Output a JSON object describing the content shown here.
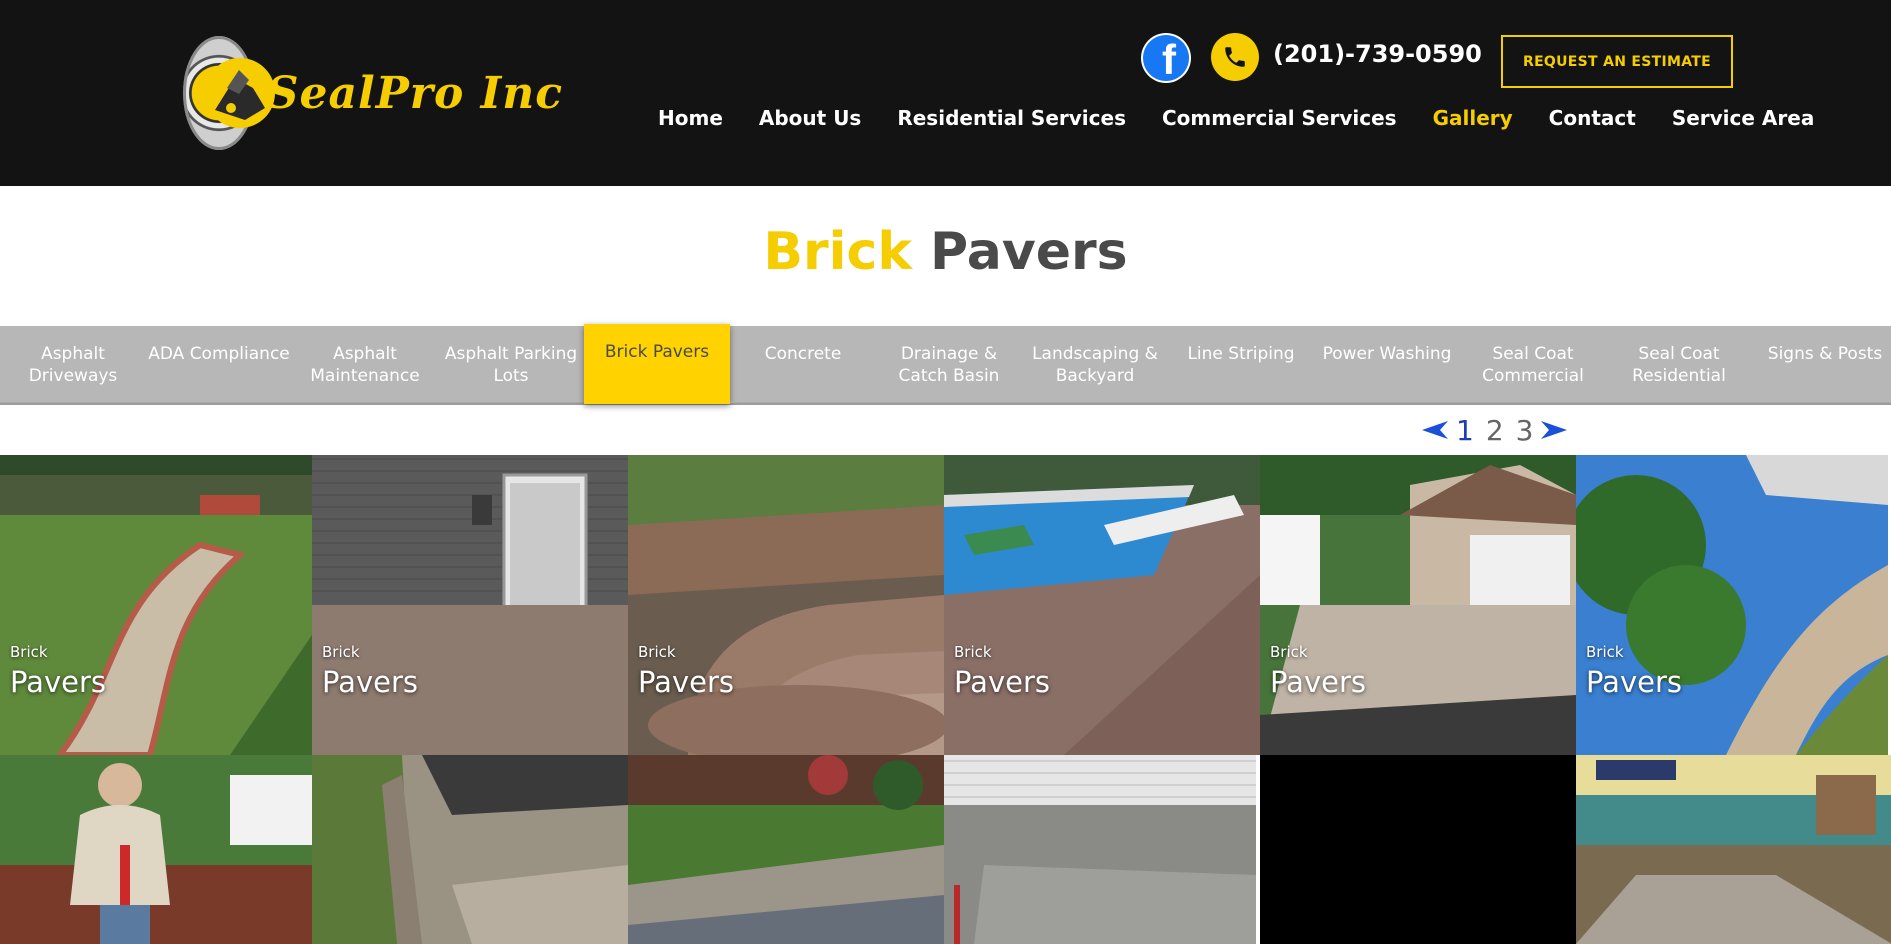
{
  "brand": {
    "name": "SealPro Inc",
    "accent": "#f5cd00",
    "header_bg": "#131313"
  },
  "header": {
    "phone": "(201)-739-0590",
    "estimate_label": "REQUEST AN ESTIMATE",
    "facebook_glyph": "f",
    "nav": [
      {
        "label": "Home"
      },
      {
        "label": "About Us"
      },
      {
        "label": "Residential Services"
      },
      {
        "label": "Commercial Services"
      },
      {
        "label": "Gallery",
        "active": true
      },
      {
        "label": "Contact"
      },
      {
        "label": "Service Area"
      }
    ]
  },
  "title": {
    "part1": "Brick",
    "part2": "Pavers"
  },
  "categories": [
    {
      "label": "Asphalt Driveways"
    },
    {
      "label": "ADA Compliance"
    },
    {
      "label": "Asphalt Maintenance"
    },
    {
      "label": "Asphalt Parking Lots"
    },
    {
      "label": "Brick Pavers",
      "active": true
    },
    {
      "label": "Concrete"
    },
    {
      "label": "Drainage & Catch Basin"
    },
    {
      "label": "Landscaping & Backyard"
    },
    {
      "label": "Line Striping"
    },
    {
      "label": "Power Washing"
    },
    {
      "label": "Seal Coat Commercial"
    },
    {
      "label": "Seal Coat Residential"
    },
    {
      "label": "Signs & Posts"
    }
  ],
  "pagination": {
    "pages": [
      "1",
      "2",
      "3"
    ],
    "current": "1",
    "arrow_color": "#1c4fd8"
  },
  "gallery": {
    "caption_small": "Brick",
    "caption_big": "Pavers",
    "tiles": [
      {
        "caption": true,
        "scene": "walkway-garden"
      },
      {
        "caption": true,
        "scene": "patio-house"
      },
      {
        "caption": true,
        "scene": "steps"
      },
      {
        "caption": true,
        "scene": "pool-deck"
      },
      {
        "caption": true,
        "scene": "garage-drive"
      },
      {
        "caption": true,
        "scene": "trees-walkway"
      },
      {
        "caption": false,
        "scene": "worker"
      },
      {
        "caption": false,
        "scene": "paver-edge"
      },
      {
        "caption": false,
        "scene": "lawn-drive"
      },
      {
        "caption": false,
        "scene": "garage-slab"
      },
      {
        "caption": false,
        "scene": "blank"
      },
      {
        "caption": false,
        "scene": "backyard"
      }
    ]
  }
}
